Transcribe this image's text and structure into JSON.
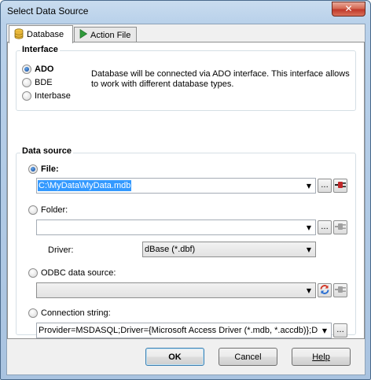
{
  "window": {
    "title": "Select Data Source",
    "close_glyph": "✕"
  },
  "tabs": [
    {
      "label": "Database",
      "icon": "database-icon",
      "active": true
    },
    {
      "label": "Action File",
      "icon": "play-arrow-icon",
      "active": false
    }
  ],
  "interface": {
    "title": "Interface",
    "options": [
      {
        "label": "ADO",
        "checked": true
      },
      {
        "label": "BDE",
        "checked": false
      },
      {
        "label": "Interbase",
        "checked": false
      }
    ],
    "description": "Database will be connected via ADO interface. This interface allows to work with different database types."
  },
  "data_source": {
    "title": "Data source",
    "file": {
      "label": "File:",
      "checked": true,
      "value": "C:\\MyData\\MyData.mdb"
    },
    "folder": {
      "label": "Folder:",
      "checked": false,
      "value": "",
      "driver_label": "Driver:",
      "driver_value": "dBase (*.dbf)"
    },
    "odbc": {
      "label": "ODBC data source:",
      "checked": false,
      "value": ""
    },
    "connection": {
      "label": "Connection string:",
      "checked": false,
      "value": "Provider=MSDASQL;Driver={Microsoft Access Driver (*.mdb, *.accdb)};DB"
    },
    "browse_glyph": "...",
    "dropdown_glyph": "▼"
  },
  "buttons": {
    "ok": "OK",
    "cancel": "Cancel",
    "help": "Help"
  },
  "colors": {
    "selection": "#3399ff",
    "plug_active": "#c0282a",
    "plug_disabled": "#a0a0a0",
    "refresh_red": "#d23a2a",
    "refresh_blue": "#2a6fd2"
  }
}
